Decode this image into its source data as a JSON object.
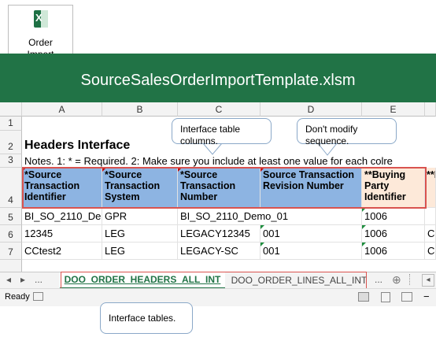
{
  "file_icon": {
    "label_line1": "Order",
    "label_line2": "Import",
    "glyph": "X"
  },
  "window": {
    "title": "SourceSalesOrderImportTemplate.xlsm"
  },
  "columns": [
    "A",
    "B",
    "C",
    "D",
    "E"
  ],
  "rows": {
    "r1": "1",
    "r2": "2",
    "r3": "3",
    "r4": "4",
    "r5": "5",
    "r6": "6",
    "r7": "7"
  },
  "sheet": {
    "heading": "Headers Interface",
    "notes": "Notes. 1: * = Required. 2: Make sure you include at least one value for each colre",
    "headers": [
      "*Source Transaction Identifier",
      "*Source Transaction System",
      "*Source Transaction Number",
      "Source Transaction Revision Number",
      "**Buying Party Identifier",
      "**Pa"
    ],
    "data": [
      [
        "BI_SO_2110_De",
        "GPR",
        "BI_SO_2110_Demo_01",
        "",
        "1006",
        ""
      ],
      [
        "12345",
        "LEG",
        "LEGACY12345",
        "001",
        "1006",
        "Co"
      ],
      [
        "CCtest2",
        "LEG",
        "LEGACY-SC",
        "001",
        "1006",
        "Co"
      ]
    ]
  },
  "callouts": {
    "columns": "Interface table columns.",
    "sequence": "Don't modify sequence.",
    "tables": "Interface tables."
  },
  "tabs": {
    "nav_prev": "◂",
    "nav_next": "▸",
    "more_left": "...",
    "active": "DOO_ORDER_HEADERS_ALL_INT",
    "inactive": "DOO_ORDER_LINES_ALL_INT",
    "more_right": "...",
    "add": "⊕"
  },
  "status": {
    "ready": "Ready",
    "zoom_minus": "−"
  },
  "colors": {
    "excel_green": "#217346",
    "header_blue": "#8db4e2",
    "header_peach": "#fde9d9",
    "callout_red": "#d9534f",
    "tab_green": "#217346"
  }
}
